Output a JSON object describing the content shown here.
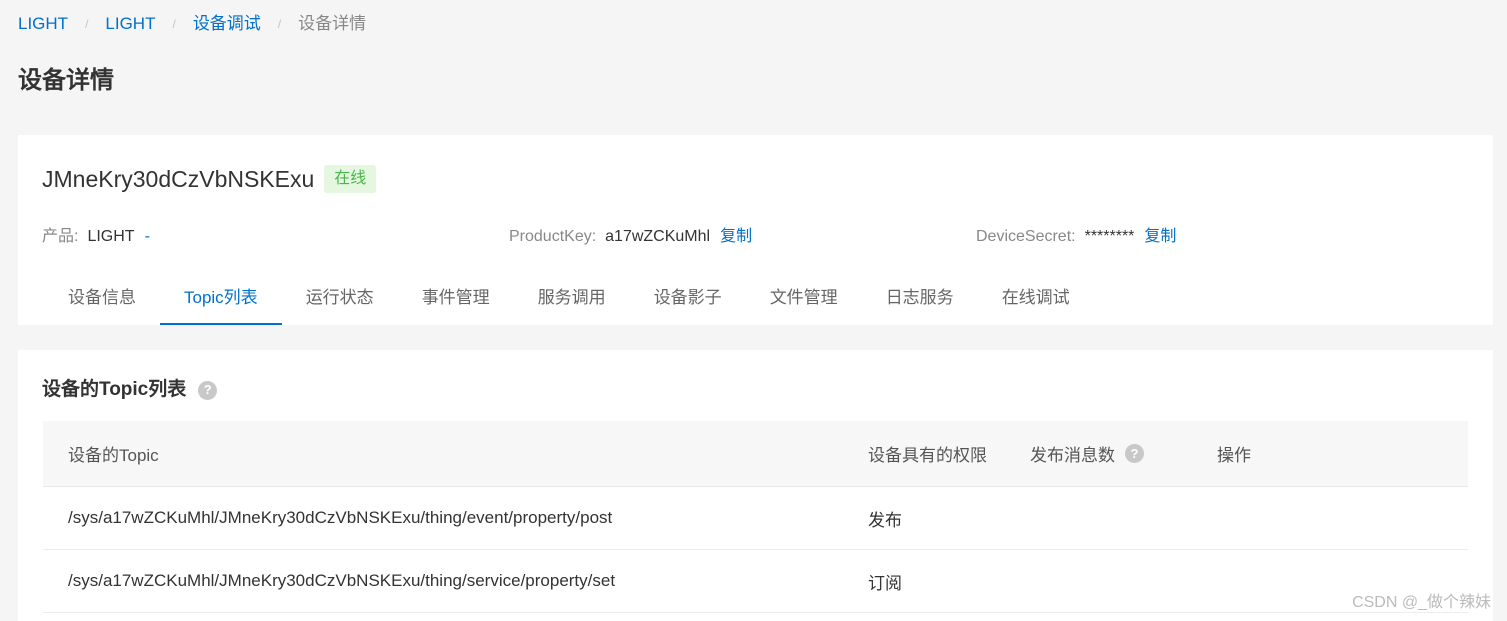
{
  "breadcrumb": [
    {
      "label": "LIGHT",
      "link": true
    },
    {
      "label": "LIGHT",
      "link": true
    },
    {
      "label": "设备调试",
      "link": true
    },
    {
      "label": "设备详情",
      "link": false
    }
  ],
  "breadcrumb_separator": "/",
  "page_title": "设备详情",
  "device": {
    "name": "JMneKry30dCzVbNSKExu",
    "status": "在线",
    "product_label": "产品:",
    "product_value": "LIGHT",
    "product_link": "-",
    "productkey_label": "ProductKey:",
    "productkey_value": "a17wZCKuMhl",
    "productkey_copy": "复制",
    "devicesecret_label": "DeviceSecret:",
    "devicesecret_value": "********",
    "devicesecret_copy": "复制"
  },
  "tabs": [
    {
      "label": "设备信息"
    },
    {
      "label": "Topic列表",
      "active": true
    },
    {
      "label": "运行状态"
    },
    {
      "label": "事件管理"
    },
    {
      "label": "服务调用"
    },
    {
      "label": "设备影子"
    },
    {
      "label": "文件管理"
    },
    {
      "label": "日志服务"
    },
    {
      "label": "在线调试"
    }
  ],
  "topic_section": {
    "title": "设备的Topic列表",
    "help_icon": "?",
    "columns": [
      "设备的Topic",
      "设备具有的权限",
      "发布消息数",
      "操作"
    ],
    "rows": [
      {
        "topic": "/sys/a17wZCKuMhl/JMneKry30dCzVbNSKExu/thing/event/property/post",
        "permission": "发布",
        "count": "",
        "action": ""
      },
      {
        "topic": "/sys/a17wZCKuMhl/JMneKry30dCzVbNSKExu/thing/service/property/set",
        "permission": "订阅",
        "count": "",
        "action": ""
      }
    ]
  },
  "watermark": "CSDN @_做个辣妹",
  "colors": {
    "accent": "#0070cc",
    "online_bg": "#e6f7e1",
    "online_text": "#4bb54b",
    "page_bg": "#f5f5f5"
  }
}
